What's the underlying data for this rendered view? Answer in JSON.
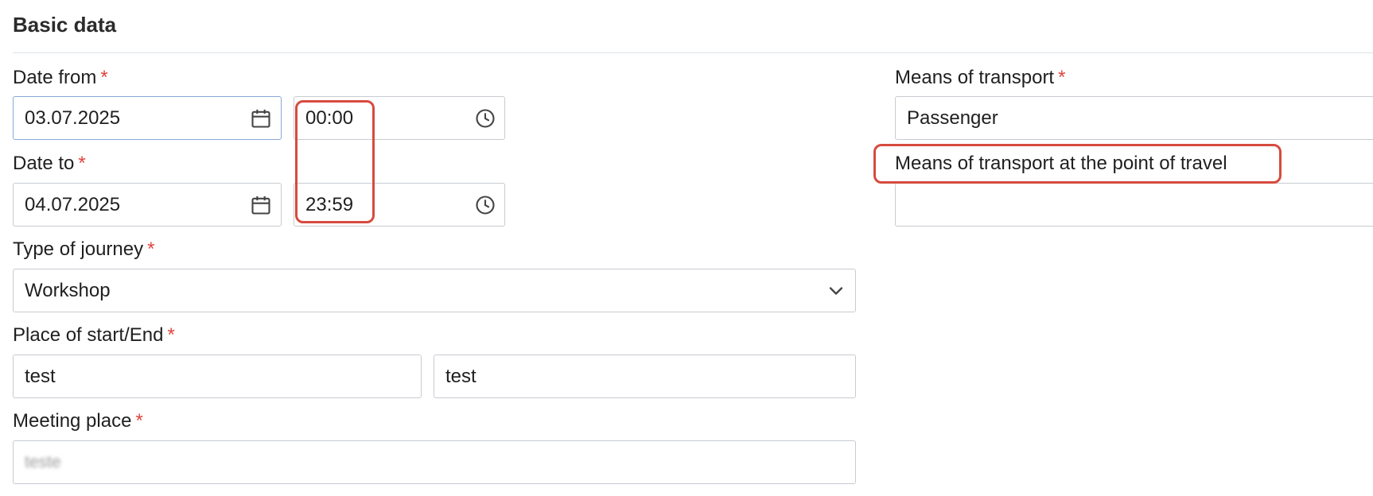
{
  "section": {
    "title": "Basic data"
  },
  "required_marker": "*",
  "date_from": {
    "label": "Date from",
    "date": "03.07.2025",
    "time": "00:00"
  },
  "date_to": {
    "label": "Date to",
    "date": "04.07.2025",
    "time": "23:59"
  },
  "type_of_journey": {
    "label": "Type of journey",
    "value": "Workshop"
  },
  "place": {
    "label": "Place of start/End",
    "start": "test",
    "end": "test"
  },
  "meeting_place": {
    "label": "Meeting place",
    "value": "teste"
  },
  "means_of_transport": {
    "label": "Means of transport",
    "value": "Passenger"
  },
  "means_at_point": {
    "label": "Means of transport at the point of travel",
    "value": ""
  },
  "icons": {
    "date": "calendar-icon",
    "time": "clock-icon",
    "select": "chevron-down-icon"
  },
  "colors": {
    "required": "#e0433d",
    "highlight": "#d64b3f",
    "border": "#c7cbd1"
  }
}
